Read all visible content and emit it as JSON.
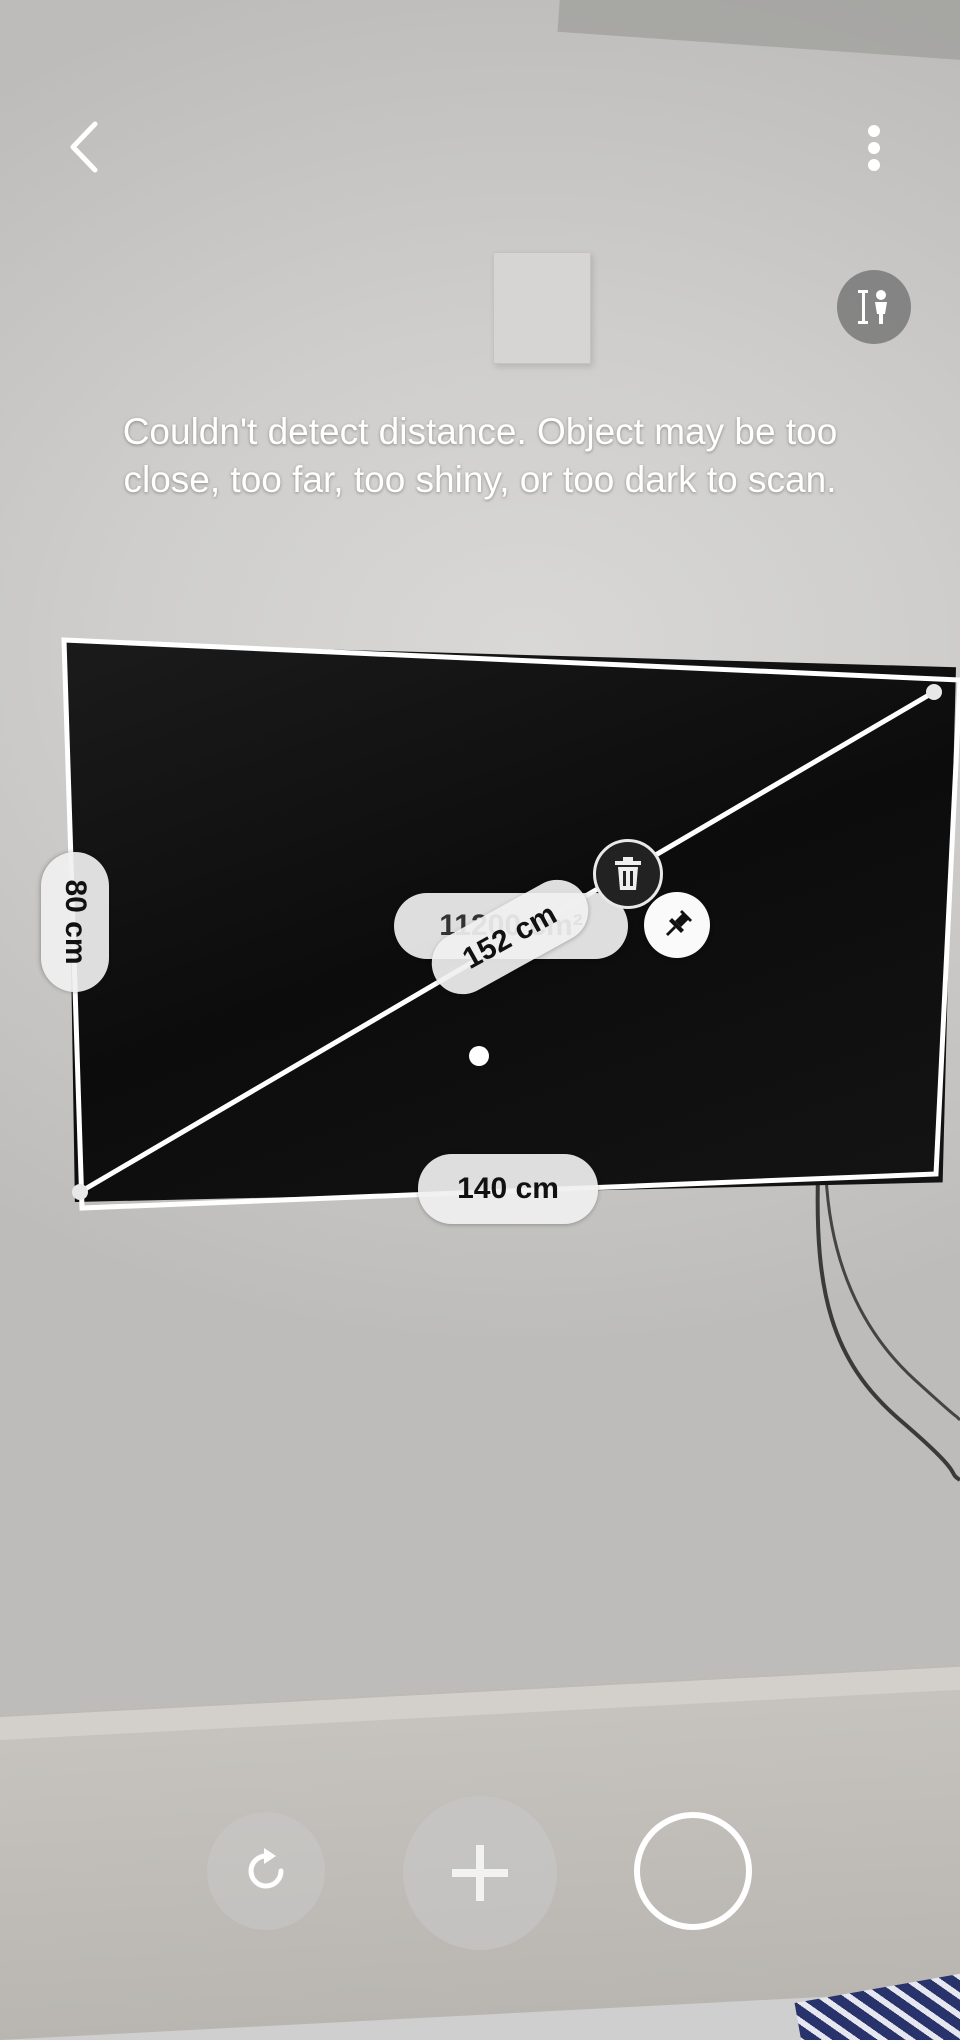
{
  "instruction": {
    "line1": "Couldn't detect distance. Object may be too",
    "line2": "close, too far, too shiny, or too dark to scan."
  },
  "measurements": {
    "width": "140 cm",
    "height": "80 cm",
    "diagonal": "152 cm",
    "area": "11200 cm²"
  },
  "toolbar": {
    "back_icon": "back-arrow-icon",
    "menu_icon": "more-options-icon",
    "height_mode_icon": "person-height-icon"
  },
  "controls": {
    "reset_icon": "reset-icon",
    "add_icon": "add-point-icon",
    "capture_icon": "capture-icon",
    "delete_icon": "trash-icon",
    "pin_icon": "pin-icon"
  },
  "colors": {
    "overlay_line": "#ffffff",
    "pill_background": "#f0f0f0",
    "pill_text": "#111111"
  }
}
